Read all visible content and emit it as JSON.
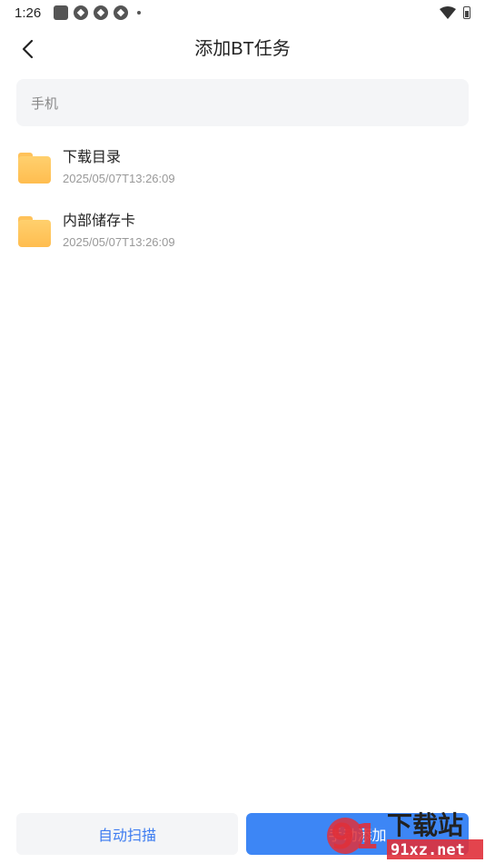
{
  "status_bar": {
    "time": "1:26"
  },
  "header": {
    "title": "添加BT任务"
  },
  "search": {
    "placeholder": "手机"
  },
  "folders": [
    {
      "name": "下载目录",
      "date": "2025/05/07T13:26:09"
    },
    {
      "name": "内部储存卡",
      "date": "2025/05/07T13:26:09"
    }
  ],
  "bottom": {
    "auto_scan_label": "自动扫描",
    "manual_add_label": "手动添加"
  },
  "watermark": {
    "brand_number": "91",
    "brand_text": "下载站",
    "url": "91xz.net"
  },
  "colors": {
    "accent": "#3d86f5",
    "folder": "#ffc25a",
    "watermark_red": "#e0303a"
  }
}
